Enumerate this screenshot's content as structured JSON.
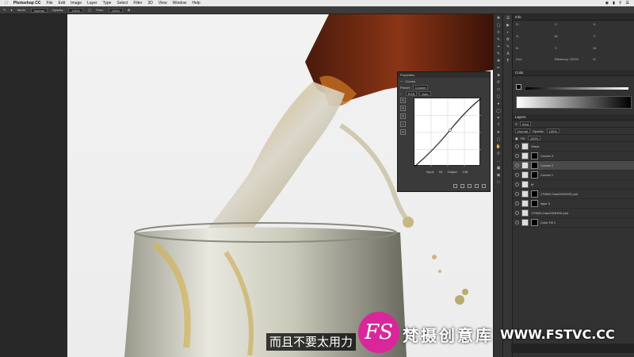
{
  "menubar": {
    "app": "Photoshop CC",
    "items": [
      "File",
      "Edit",
      "Image",
      "Layer",
      "Type",
      "Select",
      "Filter",
      "3D",
      "View",
      "Window",
      "Help"
    ]
  },
  "options": {
    "mode_label": "Mode:",
    "mode_value": "Normal",
    "opacity_label": "Opacity:",
    "opacity_value": "100%",
    "flow_label": "Flow:",
    "flow_value": "100%"
  },
  "panels": {
    "info_tab": "Info",
    "color_tab": "Color",
    "layers_tab": "Layers",
    "info_rows": [
      "R:",
      "G:",
      "B:",
      "C:",
      "M:",
      "Y:",
      "X:",
      "Y:",
      "W:",
      "H:",
      "Doc:",
      "Efficiency: 100%*"
    ],
    "blend_mode": "Normal",
    "opacity_label": "Opacity:",
    "opacity_value": "100%",
    "fill_label": "Fill:",
    "fill_value": "100%",
    "kind_label": "Kind"
  },
  "layers": [
    {
      "name": "Glass",
      "thumb": "folder",
      "mask": false
    },
    {
      "name": "Curves 3",
      "thumb": "adj",
      "mask": true
    },
    {
      "name": "Curves 2",
      "thumb": "adj",
      "mask": true,
      "selected": true
    },
    {
      "name": "Curves 1",
      "thumb": "adj",
      "mask": true
    },
    {
      "name": "bf",
      "thumb": "img",
      "mask": false
    },
    {
      "name": "170603-OasGGNHSS.psd",
      "thumb": "img",
      "mask": true
    },
    {
      "name": "layer 3",
      "thumb": "img",
      "mask": true
    },
    {
      "name": "170603-OasGGNHSS.psd",
      "thumb": "img",
      "mask": false
    },
    {
      "name": "Color Fill 1",
      "thumb": "fill",
      "mask": true
    }
  ],
  "properties": {
    "title": "Properties",
    "adj_name": "Curves",
    "preset_label": "Preset:",
    "preset_value": "Custom",
    "channel_value": "RGB",
    "auto_label": "Auto",
    "input_label": "Input:",
    "input_value": "94",
    "output_label": "Output:",
    "output_value": "138"
  },
  "subtitle": "而且不要太用力",
  "watermark": {
    "logo_letters": "FS",
    "name": "梵摄创意库",
    "url": "WWW.FSTVC.CC"
  },
  "colors": {
    "logo": "#d9279b",
    "canvas_bg": "#f0f0f0",
    "panel_bg": "#323232"
  }
}
